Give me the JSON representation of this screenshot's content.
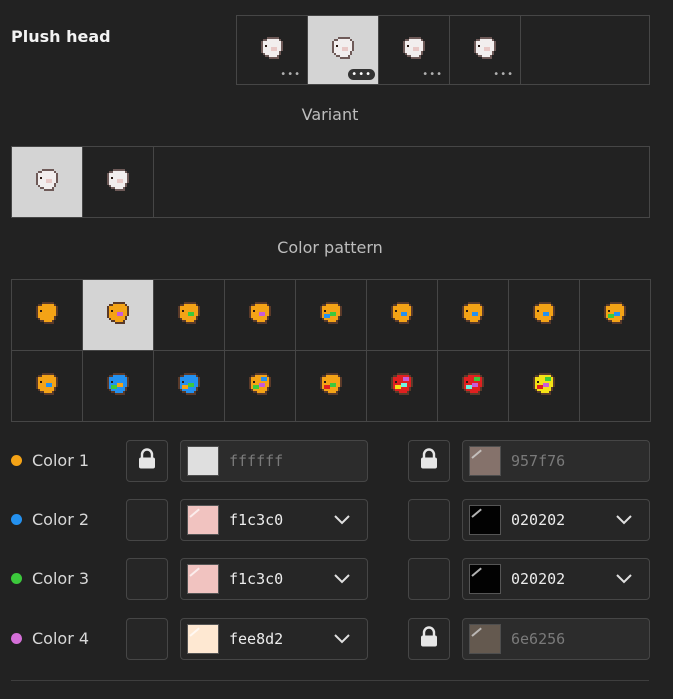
{
  "header": {
    "title": "Plush head"
  },
  "plush_head_options": [
    {
      "id": "head-1",
      "selected": false,
      "more": "•••"
    },
    {
      "id": "head-2",
      "selected": true,
      "more": "•••"
    },
    {
      "id": "head-3",
      "selected": false,
      "more": "•••"
    },
    {
      "id": "head-4",
      "selected": false,
      "more": "•••"
    }
  ],
  "variant": {
    "label": "Variant",
    "options": [
      {
        "id": "variant-1",
        "selected": true
      },
      {
        "id": "variant-2",
        "selected": false
      }
    ]
  },
  "color_pattern": {
    "label": "Color pattern",
    "patterns": [
      {
        "colors": [
          "#f4a316"
        ],
        "selected": false
      },
      {
        "colors": [
          "#f4a316",
          "#c95cd8"
        ],
        "selected": true
      },
      {
        "colors": [
          "#f4a316",
          "#3cc93c"
        ],
        "selected": false
      },
      {
        "colors": [
          "#f4a316",
          "#c95cd8"
        ],
        "selected": false
      },
      {
        "colors": [
          "#f4a316",
          "#3cc93c",
          "#2491ef"
        ],
        "selected": false
      },
      {
        "colors": [
          "#f4a316",
          "#2491ef"
        ],
        "selected": false
      },
      {
        "colors": [
          "#f4a316",
          "#2491ef"
        ],
        "selected": false
      },
      {
        "colors": [
          "#f4a316",
          "#2491ef"
        ],
        "selected": false
      },
      {
        "colors": [
          "#f4a316",
          "#2491ef",
          "#3cc93c"
        ],
        "selected": false
      },
      {
        "colors": [
          "#f4a316",
          "#2491ef"
        ],
        "selected": false
      },
      {
        "colors": [
          "#2491ef",
          "#f4a316",
          "#3cc93c"
        ],
        "selected": false
      },
      {
        "colors": [
          "#2491ef",
          "#3cc93c",
          "#f4a316"
        ],
        "selected": false
      },
      {
        "colors": [
          "#f4a316",
          "#c95cd8",
          "#3cc93c",
          "#2491ef"
        ],
        "selected": false
      },
      {
        "colors": [
          "#f4a316",
          "#3cc93c",
          "#e02020"
        ],
        "selected": false
      },
      {
        "colors": [
          "#e02020",
          "#6ef2e0",
          "#f4e216",
          "#c95cd8"
        ],
        "selected": false
      },
      {
        "colors": [
          "#e02020",
          "#c95cd8",
          "#6ef2e0",
          "#3cc93c"
        ],
        "selected": false
      },
      {
        "colors": [
          "#f4e216",
          "#c95cd8",
          "#e02020",
          "#3cc93c"
        ],
        "selected": false
      }
    ]
  },
  "color_rows": [
    {
      "label": "Color 1",
      "dot": "#f4a316",
      "left": {
        "locked": true,
        "swatch": "#ffffff",
        "hex": "ffffff",
        "disabled": true,
        "dropdown": false
      },
      "right": {
        "locked": true,
        "swatch": "#957f76",
        "hex": "957f76",
        "disabled": true,
        "dropdown": false
      }
    },
    {
      "label": "Color 2",
      "dot": "#2491ef",
      "left": {
        "locked": false,
        "swatch": "#f1c3c0",
        "hex": "f1c3c0",
        "disabled": false,
        "dropdown": true
      },
      "right": {
        "locked": false,
        "swatch": "#020202",
        "hex": "020202",
        "disabled": false,
        "dropdown": true
      }
    },
    {
      "label": "Color 3",
      "dot": "#3cc93c",
      "left": {
        "locked": false,
        "swatch": "#f1c3c0",
        "hex": "f1c3c0",
        "disabled": false,
        "dropdown": true
      },
      "right": {
        "locked": false,
        "swatch": "#020202",
        "hex": "020202",
        "disabled": false,
        "dropdown": true
      }
    },
    {
      "label": "Color 4",
      "dot": "#d46fd8",
      "left": {
        "locked": false,
        "swatch": "#fee8d2",
        "hex": "fee8d2",
        "disabled": false,
        "dropdown": true
      },
      "right": {
        "locked": true,
        "swatch": "#6e6256",
        "hex": "6e6256",
        "disabled": true,
        "dropdown": false
      }
    }
  ]
}
